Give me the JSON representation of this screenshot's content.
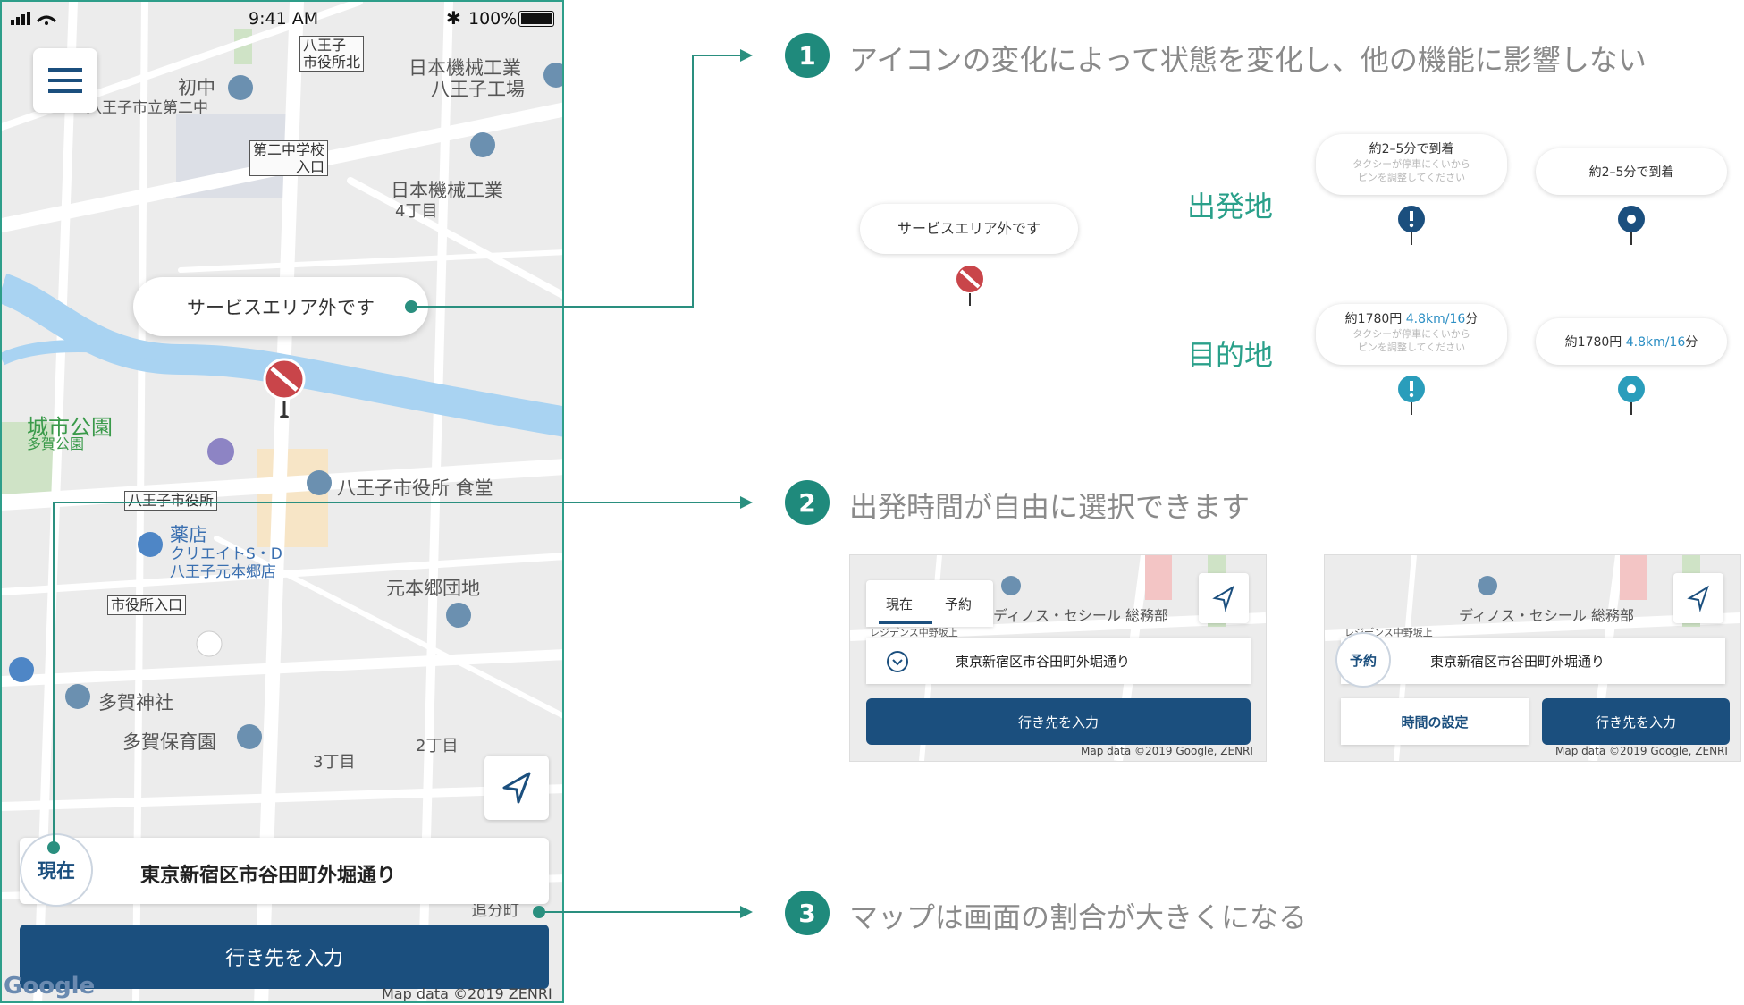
{
  "phone": {
    "status": {
      "time": "9:41 AM",
      "battery": "100%"
    },
    "map_labels": {
      "hachioji_city_office_north": "八王子\n市役所北",
      "hachioji_north_1": "八王子",
      "hachioji_north_2": "市役所北",
      "nihon_kikai_factory_1": "日本機械工業",
      "nihon_kikai_factory_2": "八王子工場",
      "hatsuchu": "初中",
      "school_line": "八王子市立第二中",
      "second_jh_entrance_1": "第二中学校",
      "second_jh_entrance_2": "入口",
      "nihon_kikai_4": "日本機械工業",
      "chome4": "4丁目",
      "city_park": "城市公園",
      "taga_park": "多賀公園",
      "city_hall_cafeteria": "八王子市役所 食堂",
      "city_hall_sign": "八王子市役所",
      "pharmacy": "薬店",
      "create_sd_1": "クリエイトS・D",
      "create_sd_2": "八王子元本郷店",
      "motohongo": "元本郷団地",
      "city_hall_entrance": "市役所入口",
      "taga_shrine": "多賀神社",
      "taga_nursery": "多賀保育園",
      "chome3": "3丁目",
      "chome2": "2丁目",
      "oiwakecho": "追分町",
      "map_data": "Map data ©2019 ZENRI"
    },
    "bubble_text": "サービスエリア外です",
    "now_label": "現在",
    "address": "東京新宿区市谷田町外堀通り",
    "cta": "行き先を入力"
  },
  "annotations": [
    {
      "num": "1",
      "text": "アイコンの変化によって状態を変化し、他の機能に影響しない"
    },
    {
      "num": "2",
      "text": "出発時間が自由に選択できます"
    },
    {
      "num": "3",
      "text": "マップは画面の割合が大きくになる"
    }
  ],
  "states": {
    "out_of_area": "サービスエリア外です",
    "departure_label": "出発地",
    "destination_label": "目的地",
    "dep_eta_a": "約2–5分で到着",
    "dep_eta_b": "約2–5分で到着",
    "dest_fare_a_prefix": "約1780円 ",
    "dest_fare_a_hl": "4.8km/16",
    "dest_fare_a_suffix": "分",
    "dest_fare_b_prefix": "約1780円 ",
    "dest_fare_b_hl": "4.8km/16",
    "dest_fare_b_suffix": "分",
    "warn_line1": "タクシーが停車にくいから",
    "warn_line2": "ピンを調整してください"
  },
  "card1": {
    "tab_now": "現在",
    "tab_reserve": "予約",
    "poi": "ディノス・セシール 総務部",
    "residence": "レジデンス中野坂上",
    "address": "東京新宿区市谷田町外堀通り",
    "cta": "行き先を入力",
    "map_data": "Map data ©2019 Google, ZENRI"
  },
  "card2": {
    "reserve": "予約",
    "poi": "ディノス・セシール 総務部",
    "residence": "レジデンス中野坂上",
    "address": "東京新宿区市谷田町外堀通り",
    "time_btn": "時間の設定",
    "cta": "行き先を入力",
    "map_data": "Map data ©2019 Google, ZENRI"
  },
  "colors": {
    "accent": "#1f8a7c",
    "navy": "#1b4f7e",
    "pin_red": "#c9454a",
    "pin_navy": "#1b4f7e",
    "pin_teal": "#2a9dbb",
    "river": "#a9d3f2"
  }
}
